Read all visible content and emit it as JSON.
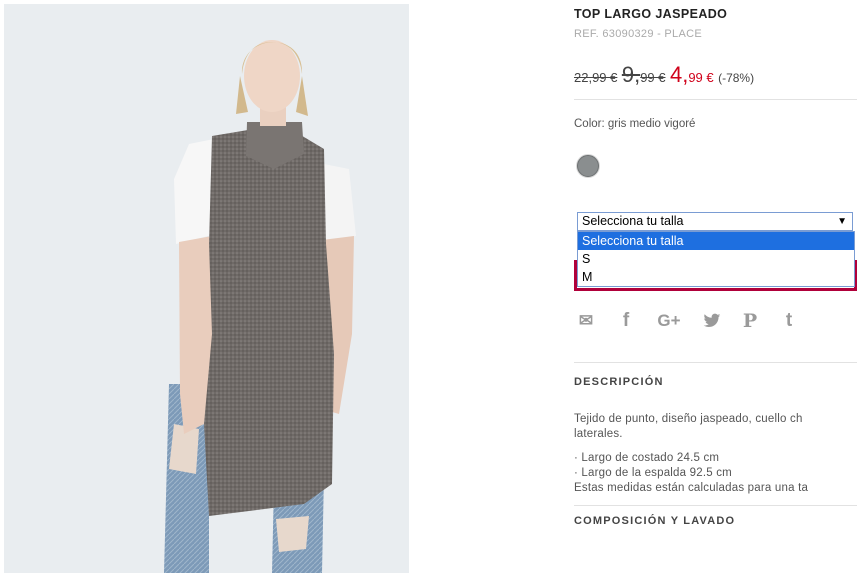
{
  "product": {
    "title": "TOP LARGO JASPEADO",
    "ref": "REF. 63090329 - PLACE",
    "price_original": "22,99 €",
    "price_prev_int": "9,",
    "price_prev_dec": "99 €",
    "price_current_int": "4,",
    "price_current_dec": "99 €",
    "discount": "(-78%)",
    "color_label": "Color: gris medio vigoré",
    "swatch_color": "#8a8e8f"
  },
  "size_select": {
    "selected": "Selecciona tu talla",
    "arrow": "▼",
    "options": [
      "Selecciona tu talla",
      "S",
      "M"
    ]
  },
  "share_icons": [
    {
      "name": "email-icon",
      "glyph": "✉"
    },
    {
      "name": "facebook-icon",
      "glyph": "f"
    },
    {
      "name": "google-plus-icon",
      "glyph": "G+"
    },
    {
      "name": "twitter-icon",
      "glyph": "🐦"
    },
    {
      "name": "pinterest-icon",
      "glyph": "P"
    },
    {
      "name": "tumblr-icon",
      "glyph": "t"
    }
  ],
  "description": {
    "heading": "DESCRIPCIÓN",
    "line1": "Tejido de punto, diseño jaspeado, cuello ch",
    "line2": "laterales.",
    "bullet1": "· Largo de costado 24.5 cm",
    "bullet2": "· Largo de la espalda 92.5 cm",
    "note": "Estas medidas están calculadas para una ta"
  },
  "composition_heading": "COMPOSICIÓN Y LAVADO",
  "colors": {
    "sale_red": "#d0021b",
    "button_border": "#b0003a",
    "select_highlight": "#1e6fe0"
  }
}
